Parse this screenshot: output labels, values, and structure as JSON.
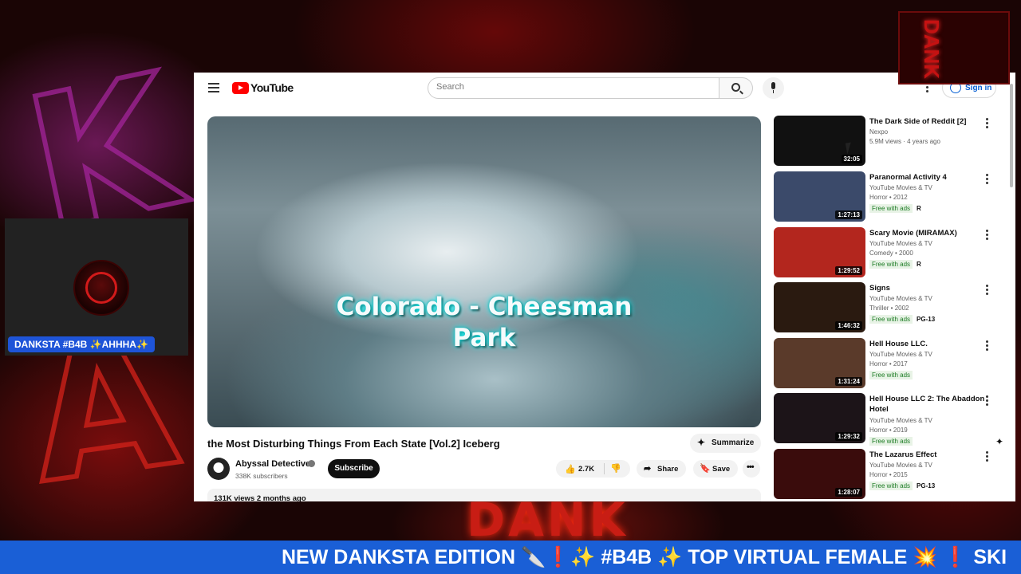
{
  "stream": {
    "webcam_label": "DANKSTA #B4B ✨AHHHA✨",
    "ticker_text": "NEW DANKSTA EDITION 🔪❗✨ #B4B ✨ TOP VIRTUAL FEMALE 💥 ❗ SKI",
    "bg_letter_1": "K",
    "bg_letter_2": "A",
    "bg_bottom_text": "DANK",
    "logo_overlay_text": "DANK",
    "colors": {
      "ticker": "#1a5fd6",
      "webcam_label": "#1e54d8"
    }
  },
  "youtube": {
    "logo_text": "YouTube",
    "search": {
      "placeholder": "Search"
    },
    "signin_label": "Sign in",
    "video": {
      "caption": "Colorado - Cheesman Park",
      "title": "the Most Disturbing Things From Each State [Vol.2] Iceberg",
      "summarize_label": "Summarize",
      "channel_name": "Abyssal Detective",
      "subscriber_count": "338K subscribers",
      "subscribe_label": "Subscribe",
      "like_count": "2.7K",
      "share_label": "Share",
      "save_label": "Save",
      "view_stats": "131K views  2 months ago"
    },
    "recommendations": [
      {
        "title": "The Dark Side of Reddit [2]",
        "channel": "Nexpo",
        "meta": "5.9M views · 4 years ago",
        "duration": "32:05",
        "badge": "",
        "rating": "",
        "thumb_color": "#111111"
      },
      {
        "title": "Paranormal Activity 4",
        "channel": "YouTube Movies & TV",
        "meta": "Horror • 2012",
        "duration": "1:27:13",
        "badge": "Free with ads",
        "rating": "R",
        "thumb_color": "#3b4a6a"
      },
      {
        "title": "Scary Movie (MIRAMAX)",
        "channel": "YouTube Movies & TV",
        "meta": "Comedy • 2000",
        "duration": "1:29:52",
        "badge": "Free with ads",
        "rating": "R",
        "thumb_color": "#b3261e"
      },
      {
        "title": "Signs",
        "channel": "YouTube Movies & TV",
        "meta": "Thriller • 2002",
        "duration": "1:46:32",
        "badge": "Free with ads",
        "rating": "PG-13",
        "thumb_color": "#2a1a10"
      },
      {
        "title": "Hell House LLC.",
        "channel": "YouTube Movies & TV",
        "meta": "Horror • 2017",
        "duration": "1:31:24",
        "badge": "Free with ads",
        "rating": "",
        "thumb_color": "#5a3a2a"
      },
      {
        "title": "Hell House LLC 2: The Abaddon Hotel",
        "channel": "YouTube Movies & TV",
        "meta": "Horror • 2019",
        "duration": "1:29:32",
        "badge": "Free with ads",
        "rating": "",
        "thumb_color": "#1c1418"
      },
      {
        "title": "The Lazarus Effect",
        "channel": "YouTube Movies & TV",
        "meta": "Horror • 2015",
        "duration": "1:28:07",
        "badge": "Free with ads",
        "rating": "PG-13",
        "thumb_color": "#3a0c0c"
      }
    ]
  }
}
